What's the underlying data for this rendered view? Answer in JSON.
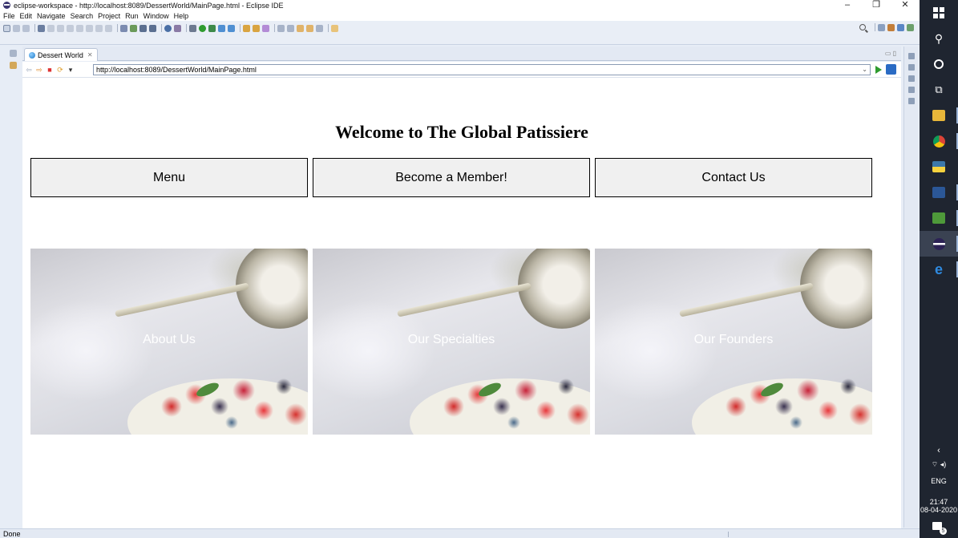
{
  "window": {
    "title": "eclipse-workspace - http://localhost:8089/DessertWorld/MainPage.html - Eclipse IDE",
    "minimize": "–",
    "maximize": "❐",
    "close": "✕"
  },
  "menu": [
    "File",
    "Edit",
    "Navigate",
    "Search",
    "Project",
    "Run",
    "Window",
    "Help"
  ],
  "editor_tab": {
    "label": "Dessert World",
    "close": "✕"
  },
  "browser": {
    "url": "http://localhost:8089/DessertWorld/MainPage.html"
  },
  "page": {
    "title": "Welcome to The Global Patissiere",
    "nav_boxes": [
      "Menu",
      "Become a Member!",
      "Contact Us"
    ],
    "tiles": [
      "About Us",
      "Our Specialties",
      "Our Founders"
    ]
  },
  "status": {
    "text": "Done"
  },
  "taskbar": {
    "language": "ENG",
    "time": "21:47",
    "date": "08-04-2020",
    "notifications": "5"
  },
  "colors": {
    "nav_box_bg": "#f0f0f0",
    "nav_box_border": "#000000",
    "taskbar_bg": "#1f2530"
  }
}
